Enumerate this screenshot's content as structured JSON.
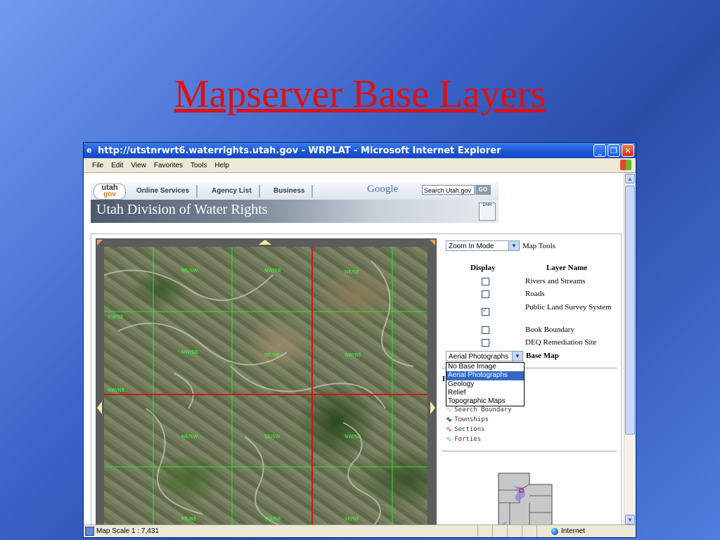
{
  "slide": {
    "title": "Mapserver Base Layers"
  },
  "window": {
    "title": "http://utstnrwrt6.waterrights.utah.gov - WRPLAT - Microsoft Internet Explorer",
    "buttons": {
      "minimize": "_",
      "maximize": "❐",
      "close": "✕"
    }
  },
  "menu": [
    "File",
    "Edit",
    "View",
    "Favorites",
    "Tools",
    "Help"
  ],
  "status": {
    "text": "Map Scale 1 : 7,431",
    "zone": "Internet"
  },
  "header": {
    "logo_top": "utah",
    "logo_bottom": "gov",
    "nav": [
      "Online Services",
      "Agency List",
      "Business"
    ],
    "google": "Google",
    "search_value": "Search Utah.gov",
    "go_label": "GO",
    "banner_title": "Utah Division of Water Rights",
    "dnr_label": "DNR"
  },
  "map": {
    "labels": [
      "NE/SW",
      "NW/SE",
      "NE/SE",
      "NW/NE",
      "NE/NE",
      "NW/NE",
      "NE/SW",
      "SE/SW",
      "NW/SE",
      "NE/NE",
      "SW/NE",
      "SE/NE",
      "NW/NE",
      "SW/SE"
    ]
  },
  "side": {
    "mode_select": "Zoom In Mode",
    "map_tools": "Map Tools",
    "col_display": "Display",
    "col_layer": "Layer Name",
    "layers": [
      {
        "name": "Rivers and Streams",
        "checked": false
      },
      {
        "name": "Roads",
        "checked": false
      },
      {
        "name": "Public Land Survey System",
        "checked": true
      },
      {
        "name": "Book Boundary",
        "checked": false
      },
      {
        "name": "DEQ Remediation Site",
        "checked": false
      }
    ],
    "base_select": "Aerial Photographs",
    "base_map_label": "Base Map",
    "base_options": [
      "No Base Image",
      "Aerial Photographs",
      "Geology",
      "Relief",
      "Topographic Maps"
    ],
    "selected_option": "Aerial Photographs",
    "legend_heading": "I",
    "legend": [
      {
        "label": "Search Boundary",
        "color": "#7fd6e8"
      },
      {
        "label": "Townships",
        "color": "#000000"
      },
      {
        "label": "Sections",
        "color": "#d02020"
      },
      {
        "label": "Forties",
        "color": "#40c040"
      }
    ]
  },
  "colors": {
    "title_red": "#e01010",
    "xp_blue": "#1c55d0",
    "selection": "#316ac5"
  }
}
